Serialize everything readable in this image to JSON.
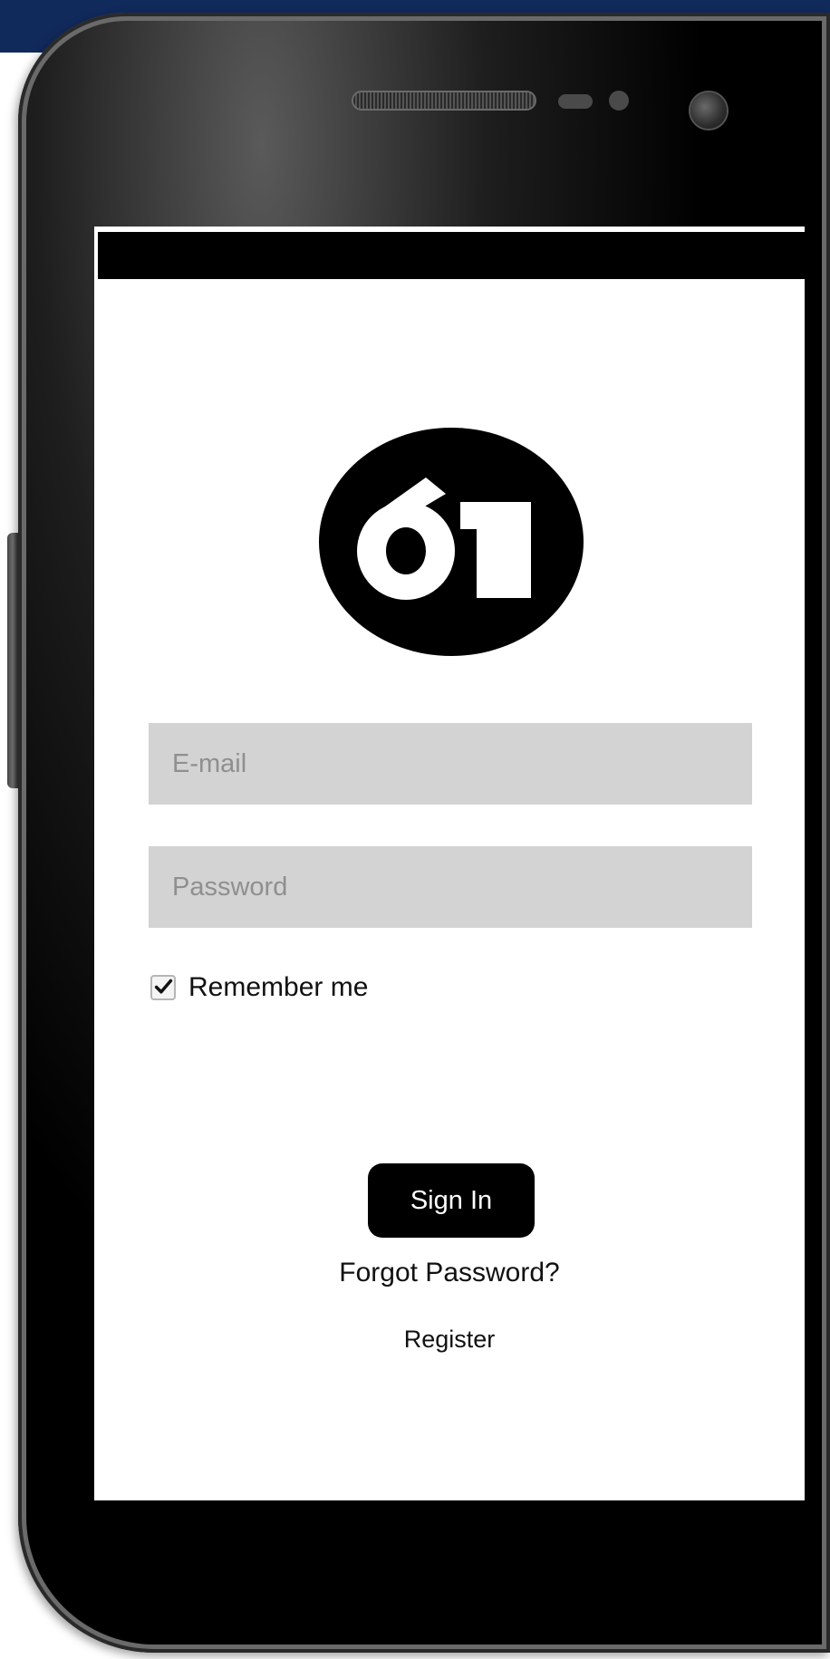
{
  "app": {
    "logo_text": "61"
  },
  "login_form": {
    "email_placeholder": "E-mail",
    "password_placeholder": "Password",
    "remember_label": "Remember me",
    "remember_checked": true,
    "signin_label": "Sign In",
    "forgot_label": "Forgot Password?",
    "register_label": "Register"
  },
  "colors": {
    "background_band": "#112a5c",
    "field_background": "#d3d3d3",
    "button_background": "#000000",
    "button_text": "#ffffff"
  }
}
